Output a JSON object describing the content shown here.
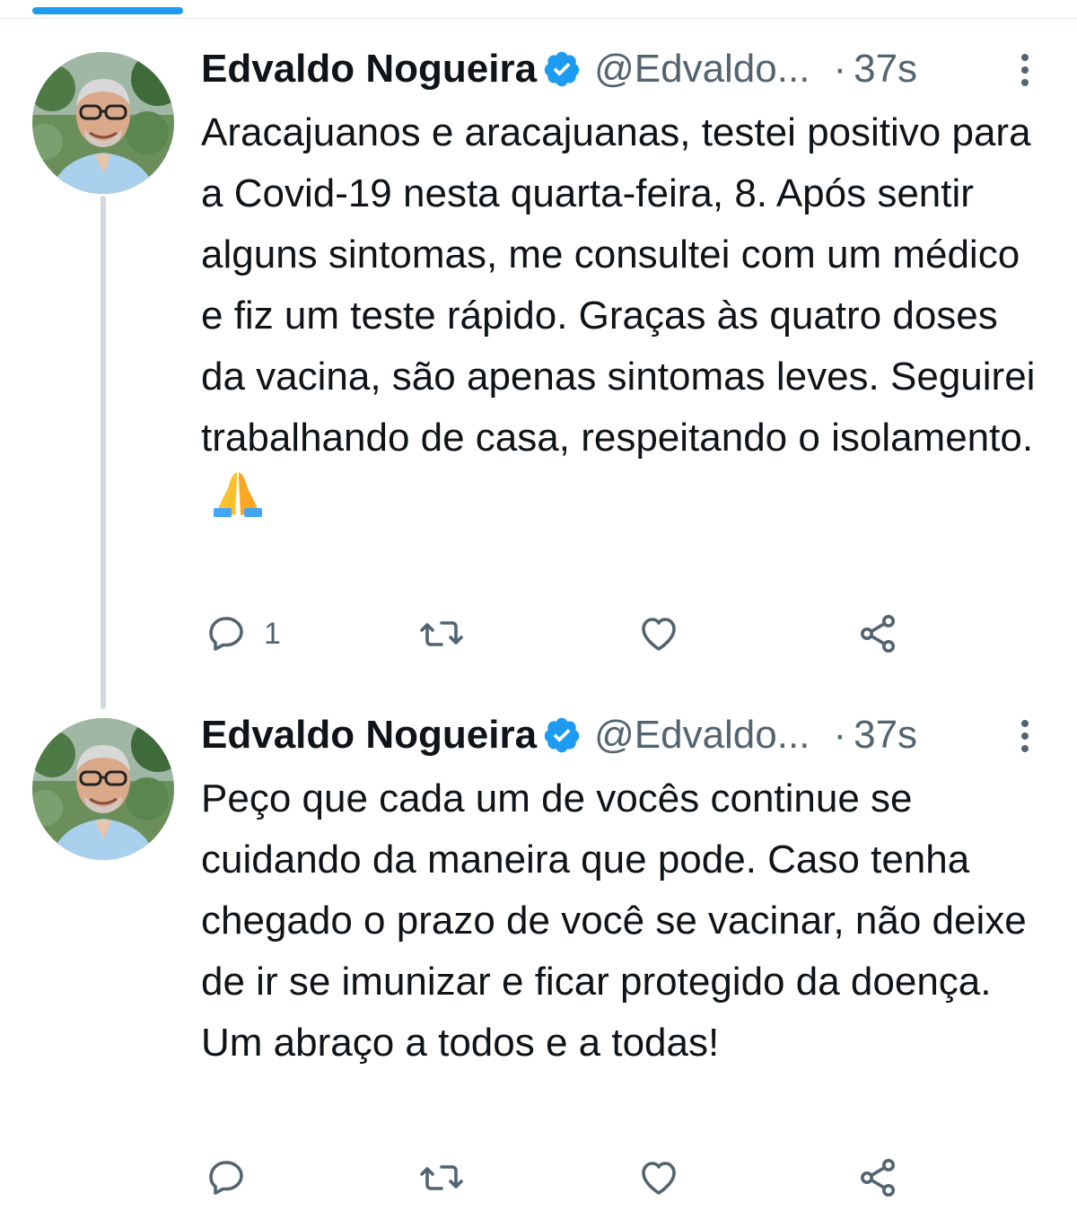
{
  "colors": {
    "accent": "#1d9bf0",
    "secondary_text": "#536471",
    "thread_line": "#cfd9de"
  },
  "tweets": [
    {
      "display_name": "Edvaldo Nogueira",
      "verified_icon": "verified-badge-icon",
      "handle": "@Edvaldo...",
      "separator": "·",
      "timestamp": "37s",
      "text": "Aracajuanos e aracajuanas, testei positivo para a Covid-19 nesta quarta-feira, 8. Após sentir alguns sintomas, me consultei com um médico e fiz um teste rápido. Graças às quatro doses da vacina, são apenas sintomas leves. Seguirei trabalhando de casa, respeitando o isolamento.",
      "emoji": "folded-hands-emoji",
      "actions": {
        "reply_count": "1",
        "retweet_count": "",
        "like_count": ""
      }
    },
    {
      "display_name": "Edvaldo Nogueira",
      "verified_icon": "verified-badge-icon",
      "handle": "@Edvaldo...",
      "separator": "·",
      "timestamp": "37s",
      "text": "Peço que cada um de vocês continue se cuidando da maneira que pode. Caso tenha chegado o prazo de você se vacinar, não deixe de ir se imunizar e ficar protegido da doença. Um abraço a todos e a todas!",
      "actions": {
        "reply_count": "",
        "retweet_count": "",
        "like_count": ""
      }
    }
  ]
}
